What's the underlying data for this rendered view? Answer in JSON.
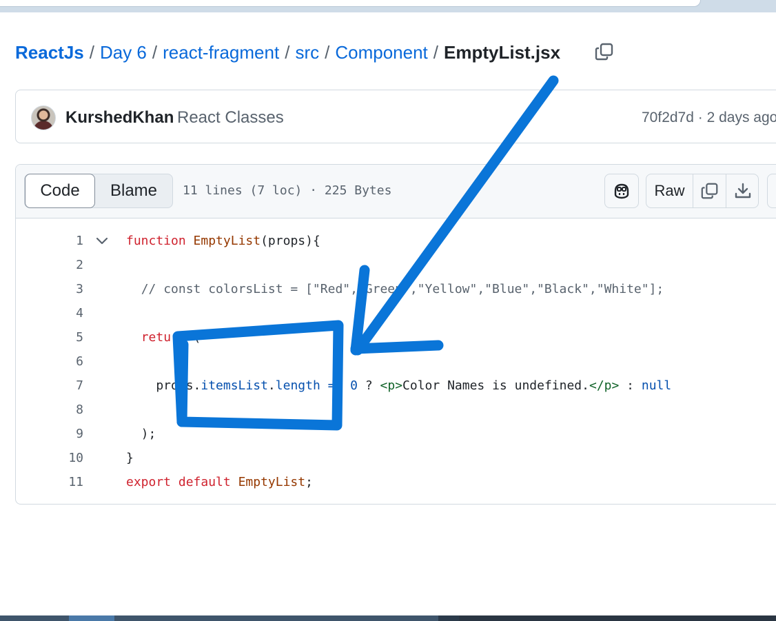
{
  "breadcrumb": {
    "items": [
      "ReactJs",
      "Day 6",
      "react-fragment",
      "src",
      "Component"
    ],
    "separator": "/",
    "current": "EmptyList.jsx"
  },
  "commit": {
    "author": "KurshedKhan",
    "message": "React Classes",
    "hash": "70f2d7d",
    "time": "2 days ago"
  },
  "file_header": {
    "tabs": [
      "Code",
      "Blame"
    ],
    "info": "11 lines (7 loc) · 225 Bytes",
    "raw_label": "Raw"
  },
  "code": {
    "line_numbers": [
      "1",
      "2",
      "3",
      "4",
      "5",
      "6",
      "7",
      "8",
      "9",
      "10",
      "11"
    ]
  },
  "colors": {
    "link": "#0969da",
    "annotation": "#0a75d8"
  },
  "icons": [
    "copy-icon",
    "copilot-icon",
    "download-icon",
    "chevron-down-icon"
  ]
}
